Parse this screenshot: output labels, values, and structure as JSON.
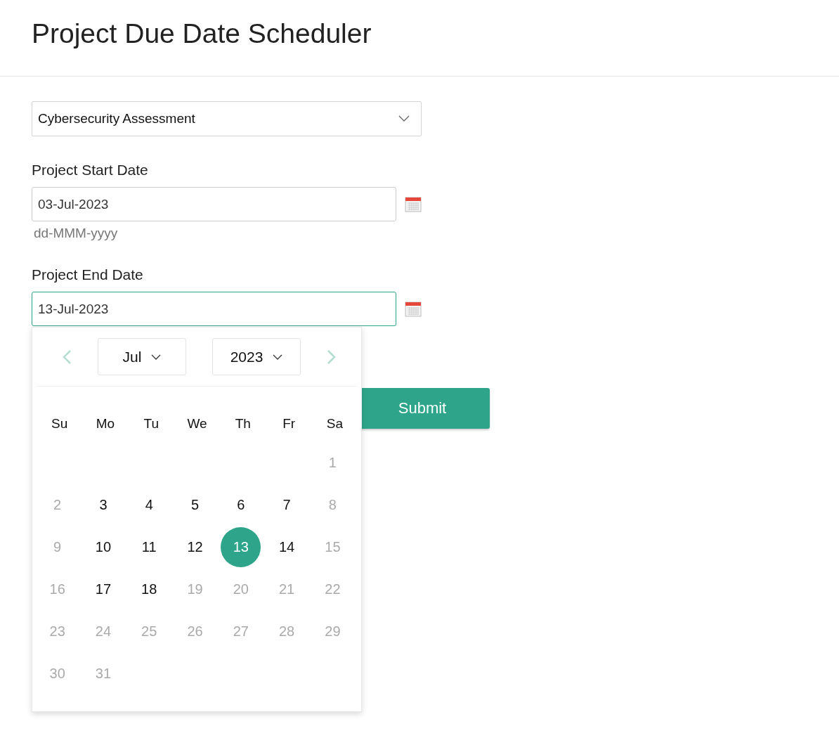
{
  "title": "Project Due Date Scheduler",
  "project_select": {
    "value": "Cybersecurity Assessment"
  },
  "start_date": {
    "label": "Project Start Date",
    "value": "03-Jul-2023",
    "hint": "dd-MMM-yyyy"
  },
  "end_date": {
    "label": "Project End Date",
    "value": "13-Jul-2023",
    "focused": true
  },
  "calendar": {
    "month": "Jul",
    "year": "2023",
    "weekdays": [
      "Su",
      "Mo",
      "Tu",
      "We",
      "Th",
      "Fr",
      "Sa"
    ],
    "weeks": [
      [
        {
          "kind": "empty"
        },
        {
          "kind": "empty"
        },
        {
          "kind": "empty"
        },
        {
          "kind": "empty"
        },
        {
          "kind": "empty"
        },
        {
          "kind": "empty"
        },
        {
          "kind": "day",
          "label": "1",
          "disabled": true,
          "selected": false
        }
      ],
      [
        {
          "kind": "day",
          "label": "2",
          "disabled": true,
          "selected": false
        },
        {
          "kind": "day",
          "label": "3",
          "disabled": false,
          "selected": false
        },
        {
          "kind": "day",
          "label": "4",
          "disabled": false,
          "selected": false
        },
        {
          "kind": "day",
          "label": "5",
          "disabled": false,
          "selected": false
        },
        {
          "kind": "day",
          "label": "6",
          "disabled": false,
          "selected": false
        },
        {
          "kind": "day",
          "label": "7",
          "disabled": false,
          "selected": false
        },
        {
          "kind": "day",
          "label": "8",
          "disabled": true,
          "selected": false
        }
      ],
      [
        {
          "kind": "day",
          "label": "9",
          "disabled": true,
          "selected": false
        },
        {
          "kind": "day",
          "label": "10",
          "disabled": false,
          "selected": false
        },
        {
          "kind": "day",
          "label": "11",
          "disabled": false,
          "selected": false
        },
        {
          "kind": "day",
          "label": "12",
          "disabled": false,
          "selected": false
        },
        {
          "kind": "day",
          "label": "13",
          "disabled": false,
          "selected": true
        },
        {
          "kind": "day",
          "label": "14",
          "disabled": false,
          "selected": false
        },
        {
          "kind": "day",
          "label": "15",
          "disabled": true,
          "selected": false
        }
      ],
      [
        {
          "kind": "day",
          "label": "16",
          "disabled": true,
          "selected": false
        },
        {
          "kind": "day",
          "label": "17",
          "disabled": false,
          "selected": false
        },
        {
          "kind": "day",
          "label": "18",
          "disabled": false,
          "selected": false
        },
        {
          "kind": "day",
          "label": "19",
          "disabled": true,
          "selected": false
        },
        {
          "kind": "day",
          "label": "20",
          "disabled": true,
          "selected": false
        },
        {
          "kind": "day",
          "label": "21",
          "disabled": true,
          "selected": false
        },
        {
          "kind": "day",
          "label": "22",
          "disabled": true,
          "selected": false
        }
      ],
      [
        {
          "kind": "day",
          "label": "23",
          "disabled": true,
          "selected": false
        },
        {
          "kind": "day",
          "label": "24",
          "disabled": true,
          "selected": false
        },
        {
          "kind": "day",
          "label": "25",
          "disabled": true,
          "selected": false
        },
        {
          "kind": "day",
          "label": "26",
          "disabled": true,
          "selected": false
        },
        {
          "kind": "day",
          "label": "27",
          "disabled": true,
          "selected": false
        },
        {
          "kind": "day",
          "label": "28",
          "disabled": true,
          "selected": false
        },
        {
          "kind": "day",
          "label": "29",
          "disabled": true,
          "selected": false
        }
      ],
      [
        {
          "kind": "day",
          "label": "30",
          "disabled": true,
          "selected": false
        },
        {
          "kind": "day",
          "label": "31",
          "disabled": true,
          "selected": false
        },
        {
          "kind": "empty"
        },
        {
          "kind": "empty"
        },
        {
          "kind": "empty"
        },
        {
          "kind": "empty"
        },
        {
          "kind": "empty"
        }
      ]
    ]
  },
  "submit_button": "Submit"
}
